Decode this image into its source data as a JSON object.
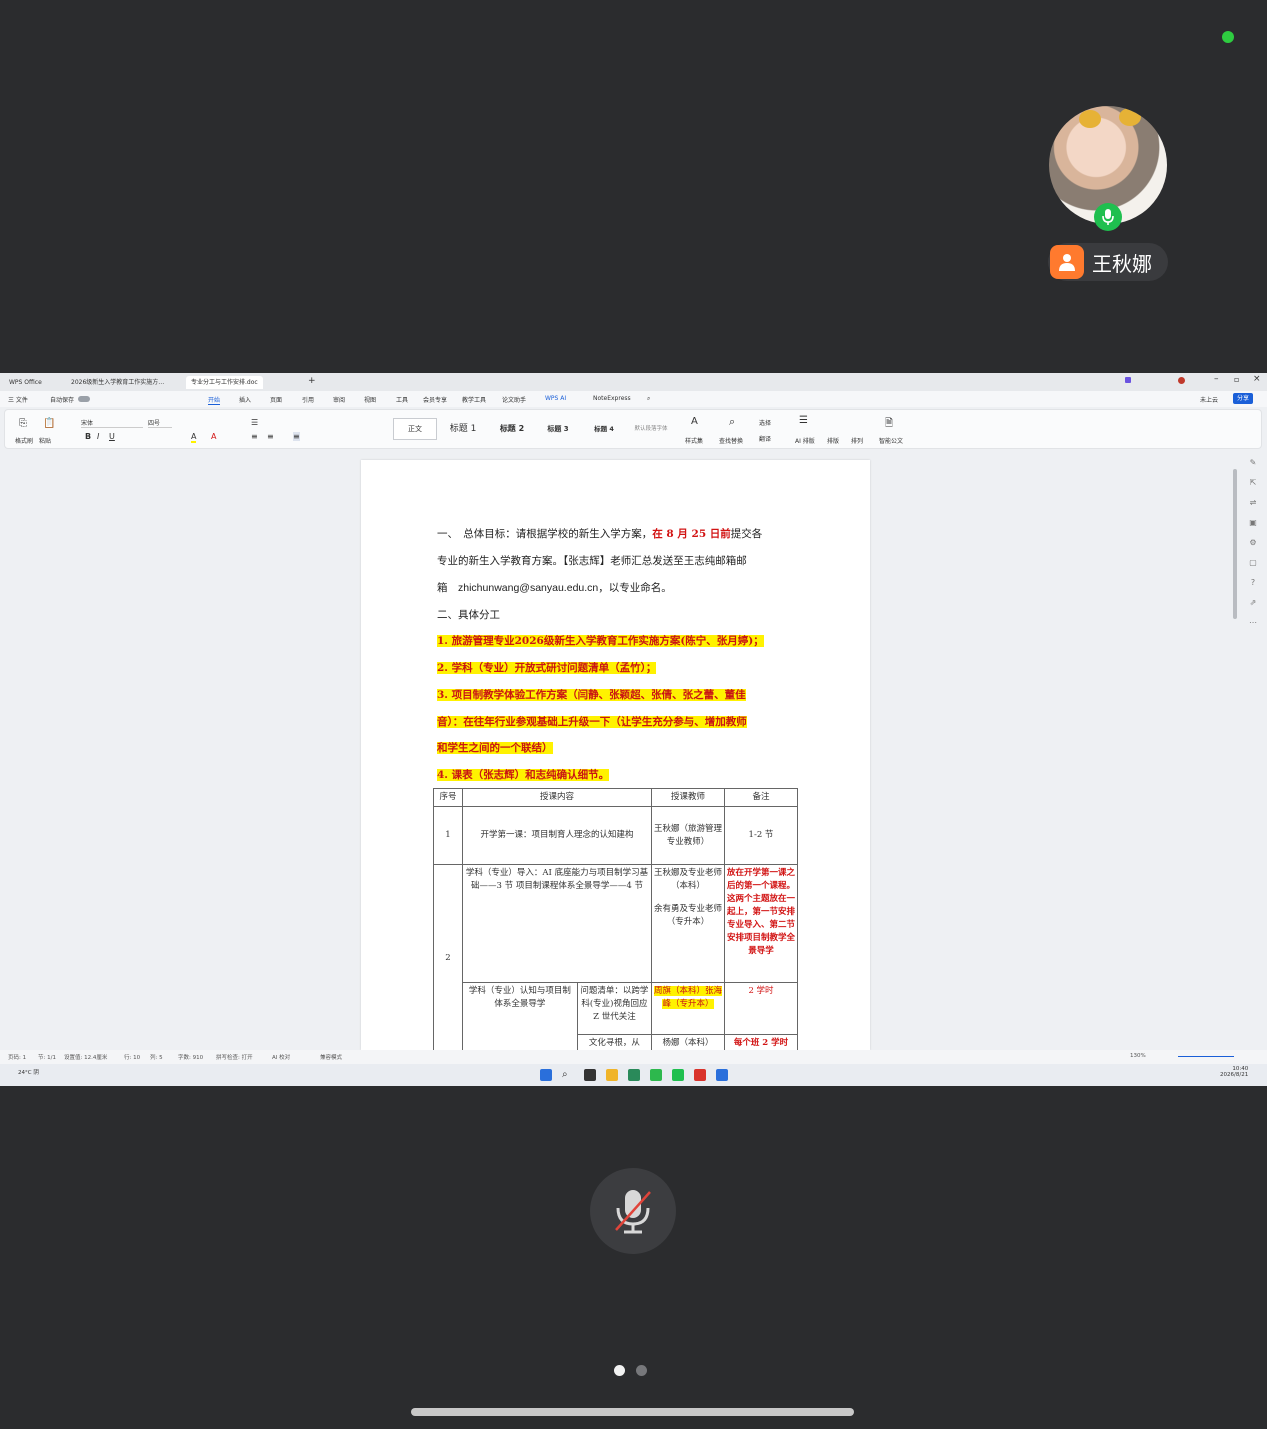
{
  "participant": {
    "name": "王秋娜"
  },
  "wps": {
    "tabs": [
      "WPS Office",
      "2026级新生入学教育工作实施方…",
      "专业分工与工作安排.doc"
    ],
    "title_buttons": [
      "未上云",
      "分享"
    ],
    "menus": [
      "三 文件",
      "自动保存",
      "开始",
      "插入",
      "页面",
      "引用",
      "审阅",
      "视图",
      "工具",
      "会员专享",
      "教学工具",
      "论文助手",
      "WPS AI",
      "NoteExpress"
    ],
    "ribbon": {
      "clipboard": [
        "格式刷",
        "粘贴"
      ],
      "font_name": "宋体",
      "font_size": "四号",
      "styles": [
        "正文",
        "标题 1",
        "标题 2",
        "标题 3",
        "标题 4",
        "默认段落字体"
      ],
      "tools": [
        "样式集",
        "查找替换",
        "选择",
        "翻译",
        "AI 排版",
        "排版",
        "排列",
        "智能公文"
      ]
    }
  },
  "doc": {
    "p1_a": "一、　总体目标：请根据学校的新生入学方案，",
    "p1_red": "在 8 月 25 日前",
    "p1_b": "提交各",
    "p2": "专业的新生入学教育方案。【张志辉】老师汇总发送至王志纯邮箱邮",
    "p3_a": "箱　",
    "email": "zhichunwang@sanyau.edu.cn",
    "p3_b": "，以专业命名。",
    "h2": "二、具体分工",
    "item1": "1. 旅游管理专业2026级新生入学教育工作实施方案(陈宁、张月婷)；",
    "item2": "2. 学科（专业）开放式研讨问题清单（孟竹）；",
    "item3a": "3. 项目制教学体验工作方案（闫静、张颖超、张倩、张之蕾、董佳",
    "item3b": "音）：在往年行业参观基础上升级一下（让学生充分参与、增加教师",
    "item3c": "和学生之间的一个联结）",
    "item4": "4. 课表（张志辉）和志纯确认细节。",
    "table": {
      "headers": [
        "序号",
        "授课内容",
        "授课教师",
        "备注"
      ],
      "r1": {
        "no": "1",
        "content": "开学第一课：项目制育人理念的认知建构",
        "teacher": "王秋娜（旅游管理专业教师）",
        "note": "1-2 节"
      },
      "r2": {
        "no": "2",
        "content": "学科（专业）导入：AI 底座能力与项目制学习基础——3 节 项目制课程体系全景导学——4 节",
        "teacher_a": "王秋娜及专业老师（本科）",
        "teacher_b": "余有勇及专业老师（专升本）",
        "note": "放在开学第一课之后的第一个课程。这两个主题放在一起上，第一节安排专业导入、第二节安排项目制教学全景导学"
      },
      "r3": {
        "content": "学科（专业）认知与项目制体系全景导学",
        "sub": "问题清单：以跨学科(专业)视角回应 Z 世代关注",
        "teacher": "周旗（本科）张海峰（专升本）",
        "note": "2 学时"
      },
      "r4": {
        "sub": "文化寻根，从",
        "teacher": "杨娜（本科）",
        "note": "每个班 2 学时"
      }
    }
  },
  "statusbar": [
    "页码: 1",
    "节: 1/1",
    "设置值: 12.4厘米",
    "行: 10",
    "列: 5",
    "字数: 910",
    "拼写检查: 打开",
    "AI 校对",
    "兼容模式",
    "130%"
  ],
  "taskbar": {
    "weather": "24°C 阴",
    "time": "10:40",
    "date": "2026/8/21"
  },
  "colors": {
    "accent": "#1a5fd8",
    "highlight": "#fff200",
    "red_text": "#d21414",
    "mic_active": "#1fbf4f"
  }
}
